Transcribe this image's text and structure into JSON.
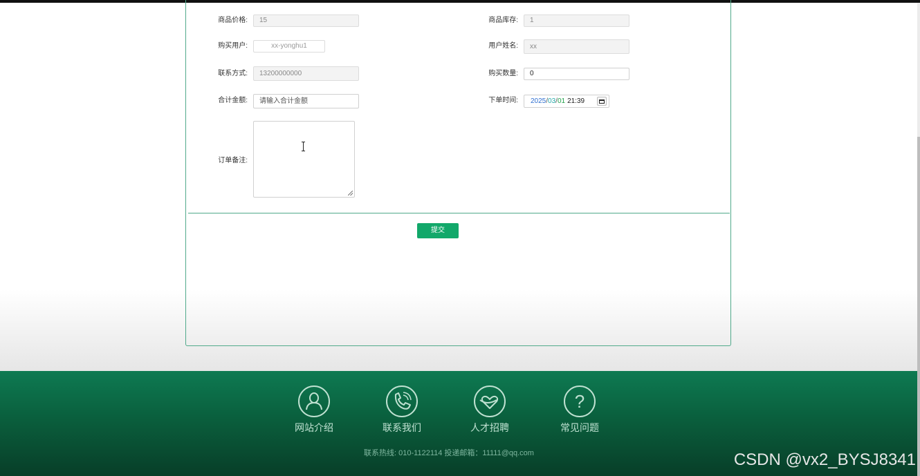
{
  "form": {
    "price_label": "商品价格:",
    "price_value": "15",
    "stock_label": "商品库存:",
    "stock_value": "1",
    "buyer_label": "购买用户:",
    "buyer_value": "xx-yonghu1",
    "name_label": "用户姓名:",
    "name_value": "xx",
    "contact_label": "联系方式:",
    "contact_value": "13200000000",
    "quantity_label": "购买数量:",
    "quantity_value": "0",
    "total_label": "合计金额:",
    "total_placeholder": "请输入合计金额",
    "order_time_label": "下单时间:",
    "order_time": {
      "year": "2025",
      "month": "03",
      "day": "01",
      "time": "21:39"
    },
    "note_label": "订单备注:",
    "note_value": "",
    "submit_label": "提交"
  },
  "footer": {
    "items": [
      {
        "label": "网站介绍",
        "icon": "person-icon"
      },
      {
        "label": "联系我们",
        "icon": "phone-icon"
      },
      {
        "label": "人才招聘",
        "icon": "heart-icon"
      },
      {
        "label": "常见问题",
        "icon": "question-icon"
      }
    ],
    "contact_text": "联系热线: 010-1122114 投递邮箱：11111@qq.com"
  },
  "watermark": "CSDN @vx2_BYSJ8341",
  "colors": {
    "accent": "#12a86a",
    "border": "#4fa98a",
    "footer": "#0e7a52"
  }
}
